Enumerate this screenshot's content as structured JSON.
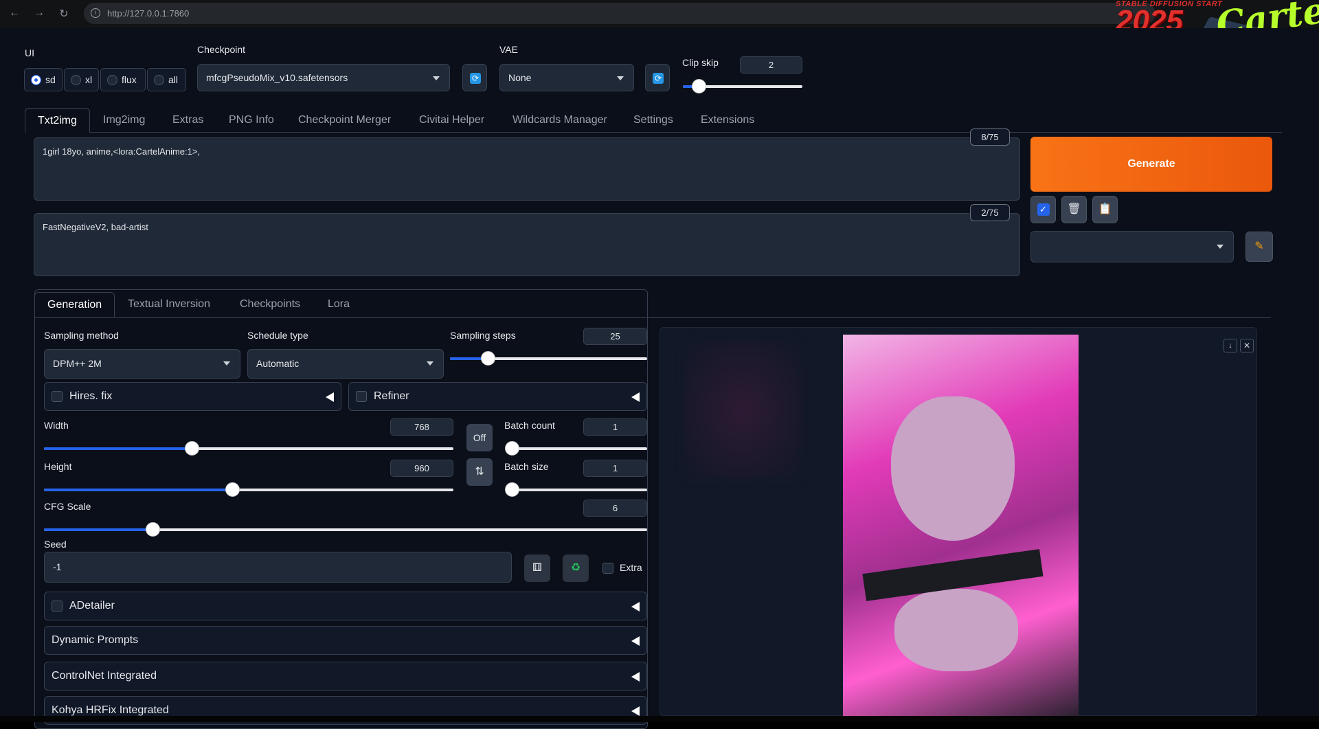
{
  "browser": {
    "url_host": "http://127.0.0.1",
    "url_port": ":7860"
  },
  "banner": {
    "small": "STABLE DIFFUSION START",
    "year": "2025",
    "tag": "Cartel"
  },
  "ui": {
    "label": "UI",
    "options": [
      "sd",
      "xl",
      "flux",
      "all"
    ],
    "selected": "sd"
  },
  "checkpoint": {
    "label": "Checkpoint",
    "value": "mfcgPseudoMix_v10.safetensors"
  },
  "vae": {
    "label": "VAE",
    "value": "None"
  },
  "clip_skip": {
    "label": "Clip skip",
    "value": "2",
    "fraction": 0.13
  },
  "tabs": [
    "Txt2img",
    "Img2img",
    "Extras",
    "PNG Info",
    "Checkpoint Merger",
    "Civitai Helper",
    "Wildcards Manager",
    "Settings",
    "Extensions"
  ],
  "prompt": {
    "text": "1girl 18yo, anime,<lora:CartelAnime:1>,",
    "tokens": "8/75"
  },
  "negative": {
    "text": "FastNegativeV2, bad-artist",
    "tokens": "2/75"
  },
  "generate": {
    "label": "Generate"
  },
  "subtabs": [
    "Generation",
    "Textual Inversion",
    "Checkpoints",
    "Lora"
  ],
  "sampling": {
    "method_label": "Sampling method",
    "method": "DPM++ 2M",
    "schedule_label": "Schedule type",
    "schedule": "Automatic",
    "steps_label": "Sampling steps",
    "steps": "25",
    "steps_fraction": 0.19
  },
  "hires": {
    "label": "Hires. fix"
  },
  "refiner": {
    "label": "Refiner"
  },
  "width": {
    "label": "Width",
    "value": "768",
    "fraction": 0.36
  },
  "height": {
    "label": "Height",
    "value": "960",
    "fraction": 0.46
  },
  "batch_count": {
    "label": "Batch count",
    "value": "1",
    "fraction": 0.0
  },
  "batch_size": {
    "label": "Batch size",
    "value": "1",
    "fraction": 0.0
  },
  "off_label": "Off",
  "cfg": {
    "label": "CFG Scale",
    "value": "6",
    "fraction": 0.18
  },
  "seed": {
    "label": "Seed",
    "value": "-1",
    "extra_label": "Extra"
  },
  "accordions": [
    "ADetailer",
    "Dynamic Prompts",
    "ControlNet Integrated",
    "Kohya HRFix Integrated"
  ],
  "colors": {
    "accent": "#2563eb",
    "generate": "#f97316",
    "hair": "#e040c8"
  }
}
